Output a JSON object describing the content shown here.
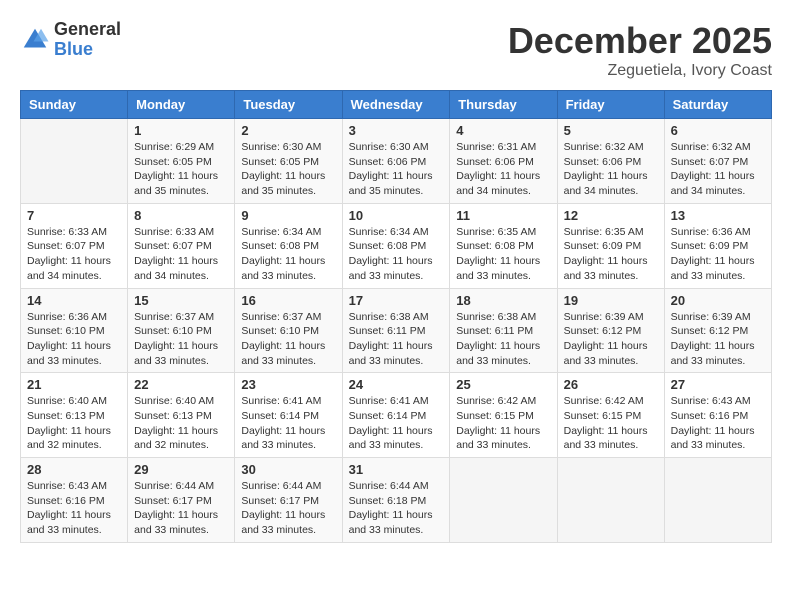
{
  "header": {
    "logo_general": "General",
    "logo_blue": "Blue",
    "month_title": "December 2025",
    "location": "Zeguetiela, Ivory Coast"
  },
  "calendar": {
    "days_of_week": [
      "Sunday",
      "Monday",
      "Tuesday",
      "Wednesday",
      "Thursday",
      "Friday",
      "Saturday"
    ],
    "weeks": [
      [
        {
          "day": "",
          "info": ""
        },
        {
          "day": "1",
          "info": "Sunrise: 6:29 AM\nSunset: 6:05 PM\nDaylight: 11 hours\nand 35 minutes."
        },
        {
          "day": "2",
          "info": "Sunrise: 6:30 AM\nSunset: 6:05 PM\nDaylight: 11 hours\nand 35 minutes."
        },
        {
          "day": "3",
          "info": "Sunrise: 6:30 AM\nSunset: 6:06 PM\nDaylight: 11 hours\nand 35 minutes."
        },
        {
          "day": "4",
          "info": "Sunrise: 6:31 AM\nSunset: 6:06 PM\nDaylight: 11 hours\nand 34 minutes."
        },
        {
          "day": "5",
          "info": "Sunrise: 6:32 AM\nSunset: 6:06 PM\nDaylight: 11 hours\nand 34 minutes."
        },
        {
          "day": "6",
          "info": "Sunrise: 6:32 AM\nSunset: 6:07 PM\nDaylight: 11 hours\nand 34 minutes."
        }
      ],
      [
        {
          "day": "7",
          "info": "Sunrise: 6:33 AM\nSunset: 6:07 PM\nDaylight: 11 hours\nand 34 minutes."
        },
        {
          "day": "8",
          "info": "Sunrise: 6:33 AM\nSunset: 6:07 PM\nDaylight: 11 hours\nand 34 minutes."
        },
        {
          "day": "9",
          "info": "Sunrise: 6:34 AM\nSunset: 6:08 PM\nDaylight: 11 hours\nand 33 minutes."
        },
        {
          "day": "10",
          "info": "Sunrise: 6:34 AM\nSunset: 6:08 PM\nDaylight: 11 hours\nand 33 minutes."
        },
        {
          "day": "11",
          "info": "Sunrise: 6:35 AM\nSunset: 6:08 PM\nDaylight: 11 hours\nand 33 minutes."
        },
        {
          "day": "12",
          "info": "Sunrise: 6:35 AM\nSunset: 6:09 PM\nDaylight: 11 hours\nand 33 minutes."
        },
        {
          "day": "13",
          "info": "Sunrise: 6:36 AM\nSunset: 6:09 PM\nDaylight: 11 hours\nand 33 minutes."
        }
      ],
      [
        {
          "day": "14",
          "info": "Sunrise: 6:36 AM\nSunset: 6:10 PM\nDaylight: 11 hours\nand 33 minutes."
        },
        {
          "day": "15",
          "info": "Sunrise: 6:37 AM\nSunset: 6:10 PM\nDaylight: 11 hours\nand 33 minutes."
        },
        {
          "day": "16",
          "info": "Sunrise: 6:37 AM\nSunset: 6:10 PM\nDaylight: 11 hours\nand 33 minutes."
        },
        {
          "day": "17",
          "info": "Sunrise: 6:38 AM\nSunset: 6:11 PM\nDaylight: 11 hours\nand 33 minutes."
        },
        {
          "day": "18",
          "info": "Sunrise: 6:38 AM\nSunset: 6:11 PM\nDaylight: 11 hours\nand 33 minutes."
        },
        {
          "day": "19",
          "info": "Sunrise: 6:39 AM\nSunset: 6:12 PM\nDaylight: 11 hours\nand 33 minutes."
        },
        {
          "day": "20",
          "info": "Sunrise: 6:39 AM\nSunset: 6:12 PM\nDaylight: 11 hours\nand 33 minutes."
        }
      ],
      [
        {
          "day": "21",
          "info": "Sunrise: 6:40 AM\nSunset: 6:13 PM\nDaylight: 11 hours\nand 32 minutes."
        },
        {
          "day": "22",
          "info": "Sunrise: 6:40 AM\nSunset: 6:13 PM\nDaylight: 11 hours\nand 32 minutes."
        },
        {
          "day": "23",
          "info": "Sunrise: 6:41 AM\nSunset: 6:14 PM\nDaylight: 11 hours\nand 33 minutes."
        },
        {
          "day": "24",
          "info": "Sunrise: 6:41 AM\nSunset: 6:14 PM\nDaylight: 11 hours\nand 33 minutes."
        },
        {
          "day": "25",
          "info": "Sunrise: 6:42 AM\nSunset: 6:15 PM\nDaylight: 11 hours\nand 33 minutes."
        },
        {
          "day": "26",
          "info": "Sunrise: 6:42 AM\nSunset: 6:15 PM\nDaylight: 11 hours\nand 33 minutes."
        },
        {
          "day": "27",
          "info": "Sunrise: 6:43 AM\nSunset: 6:16 PM\nDaylight: 11 hours\nand 33 minutes."
        }
      ],
      [
        {
          "day": "28",
          "info": "Sunrise: 6:43 AM\nSunset: 6:16 PM\nDaylight: 11 hours\nand 33 minutes."
        },
        {
          "day": "29",
          "info": "Sunrise: 6:44 AM\nSunset: 6:17 PM\nDaylight: 11 hours\nand 33 minutes."
        },
        {
          "day": "30",
          "info": "Sunrise: 6:44 AM\nSunset: 6:17 PM\nDaylight: 11 hours\nand 33 minutes."
        },
        {
          "day": "31",
          "info": "Sunrise: 6:44 AM\nSunset: 6:18 PM\nDaylight: 11 hours\nand 33 minutes."
        },
        {
          "day": "",
          "info": ""
        },
        {
          "day": "",
          "info": ""
        },
        {
          "day": "",
          "info": ""
        }
      ]
    ]
  }
}
